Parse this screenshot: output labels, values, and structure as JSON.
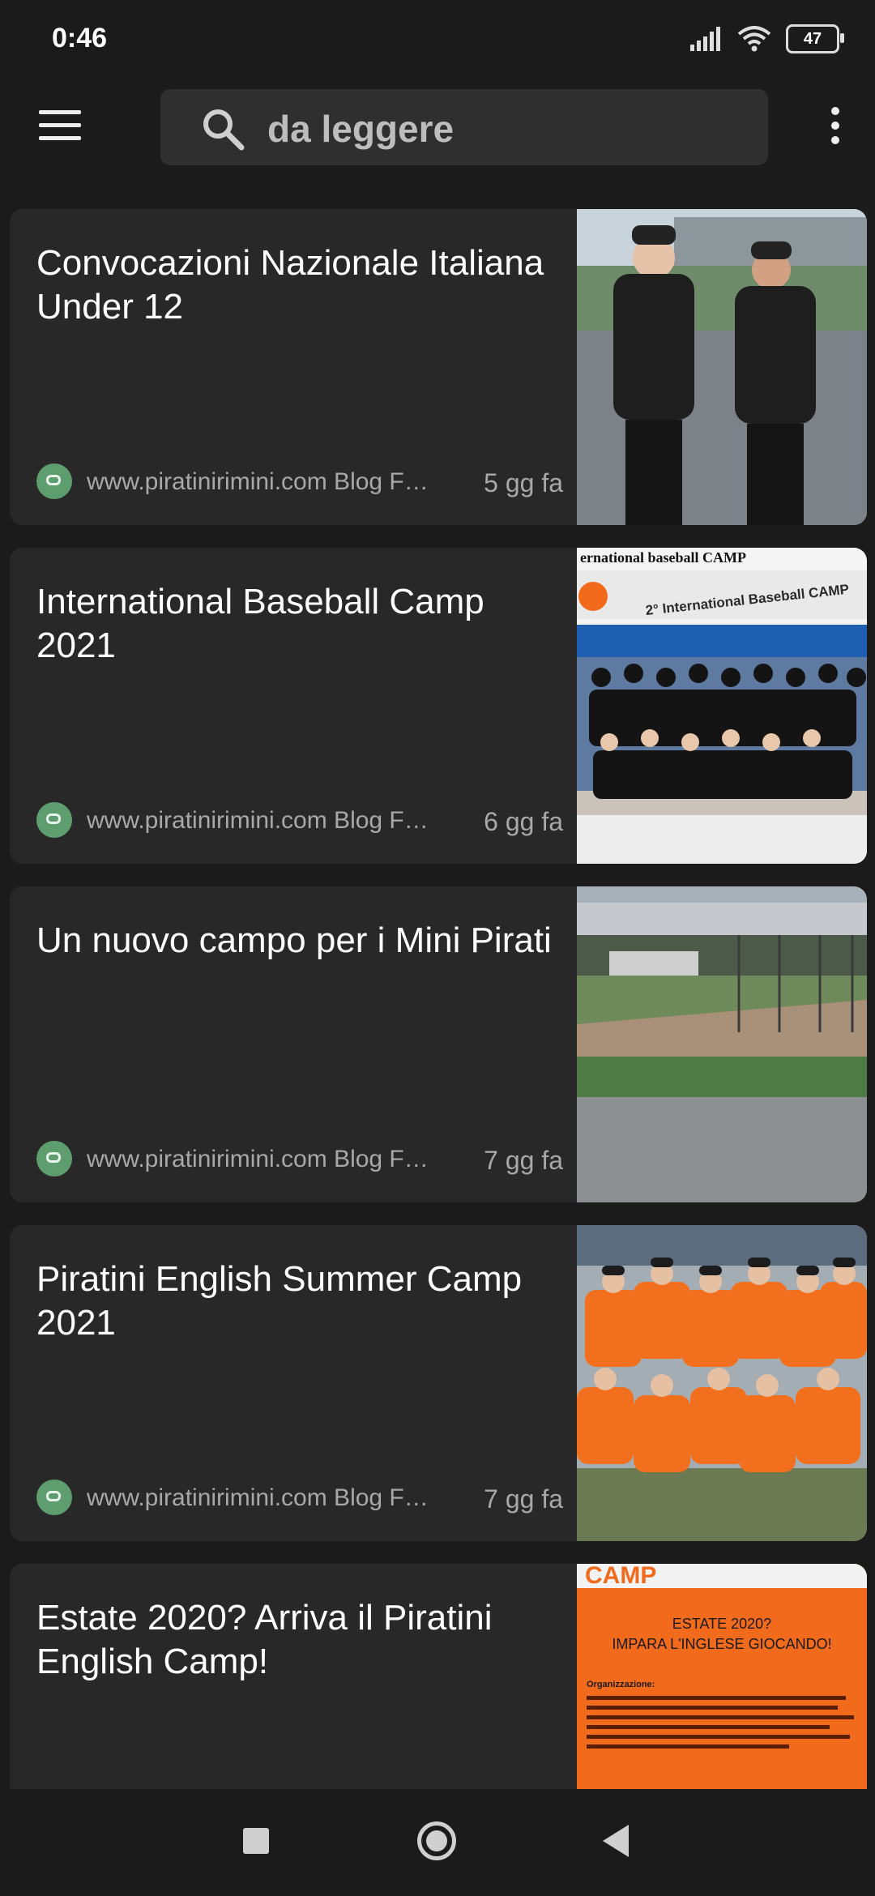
{
  "status_bar": {
    "time": "0:46",
    "battery": "47"
  },
  "search": {
    "query": "da leggere"
  },
  "articles": [
    {
      "title": "Convocazioni Nazionale Italiana Under 12",
      "source": "www.piratinirimini.com Blog Fe...",
      "age": "5 gg fa"
    },
    {
      "title": "International Baseball Camp 2021",
      "source": "www.piratinirimini.com Blog Fe...",
      "age": "6 gg fa",
      "thumb_text": {
        "header": "ernational baseball CAMP",
        "banner": "2° International Baseball CAMP"
      }
    },
    {
      "title": "Un nuovo campo per i Mini Pirati",
      "source": "www.piratinirimini.com Blog Fe...",
      "age": "7 gg fa"
    },
    {
      "title": "Piratini English Summer Camp 2021",
      "source": "www.piratinirimini.com Blog Fe...",
      "age": "7 gg fa"
    },
    {
      "title": "Estate 2020? Arriva il Piratini English Camp!",
      "source": "",
      "age": "",
      "thumb_text": {
        "head": "CAMP",
        "line1": "ESTATE 2020?",
        "line2": "IMPARA L'INGLESE GIOCANDO!",
        "org": "Organizzazione:"
      }
    }
  ],
  "colors": {
    "background": "#1b1b1b",
    "card": "#282828",
    "source_icon": "#5e9e6e",
    "accent_orange": "#f26b1d"
  }
}
